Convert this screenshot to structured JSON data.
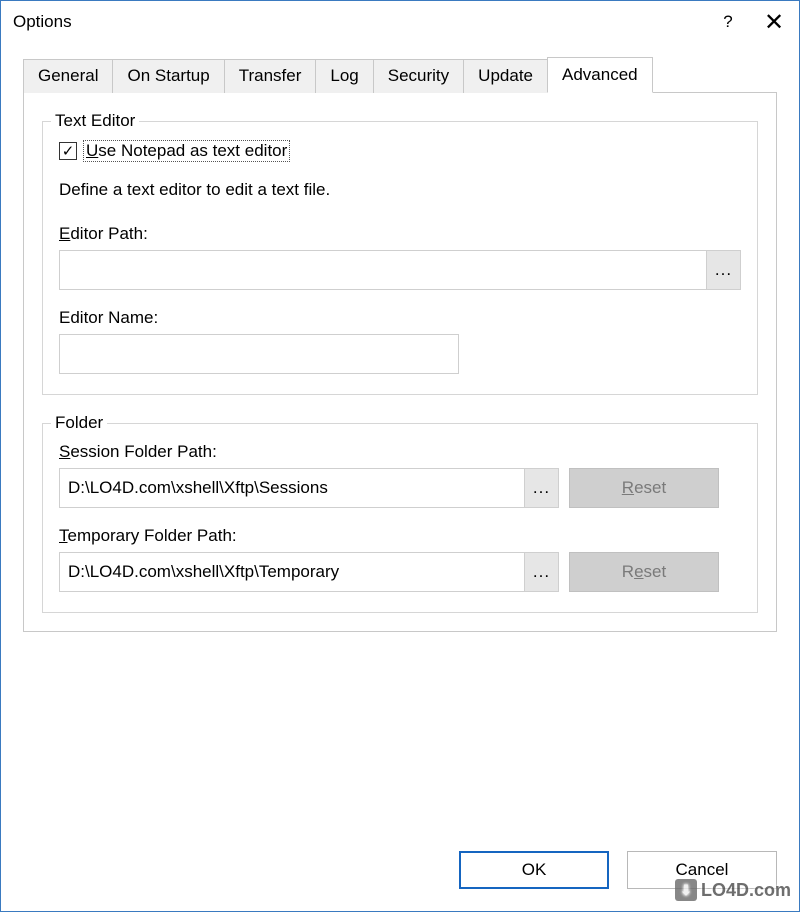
{
  "window": {
    "title": "Options"
  },
  "tabs": [
    {
      "label": "General"
    },
    {
      "label": "On Startup"
    },
    {
      "label": "Transfer"
    },
    {
      "label": "Log"
    },
    {
      "label": "Security"
    },
    {
      "label": "Update"
    },
    {
      "label": "Advanced"
    }
  ],
  "text_editor": {
    "group_title": "Text Editor",
    "use_notepad_label": "Use Notepad as text editor",
    "use_notepad_checked": true,
    "description": "Define a text editor to edit a text file.",
    "editor_path_label": "Editor Path:",
    "editor_path_value": "",
    "browse_label": "...",
    "editor_name_label": "Editor Name:",
    "editor_name_value": ""
  },
  "folder": {
    "group_title": "Folder",
    "session_label": "Session Folder Path:",
    "session_value": "D:\\LO4D.com\\xshell\\Xftp\\Sessions",
    "temp_label": "Temporary Folder Path:",
    "temp_value": "D:\\LO4D.com\\xshell\\Xftp\\Temporary",
    "browse_label": "...",
    "reset_label": "Reset"
  },
  "buttons": {
    "ok": "OK",
    "cancel": "Cancel"
  },
  "watermark": "LO4D.com"
}
